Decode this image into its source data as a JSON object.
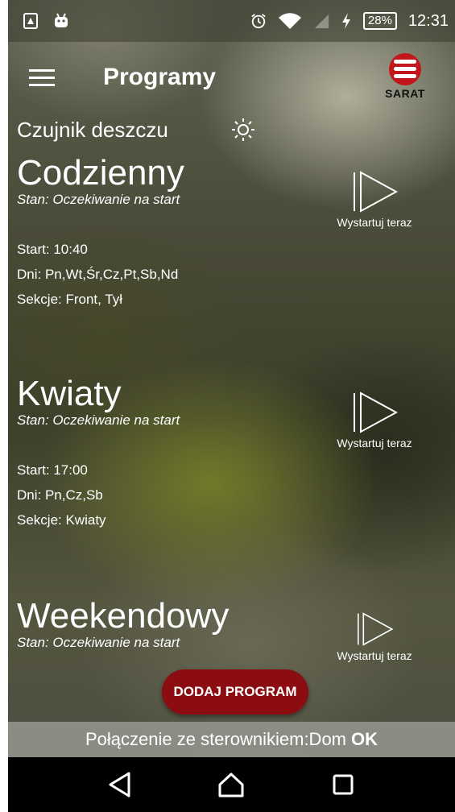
{
  "status_bar": {
    "battery_percent": "28%",
    "time": "12:31",
    "icons": [
      "sim-card-icon",
      "android-icon",
      "alarm-icon",
      "wifi-icon",
      "signal-icon",
      "charging-icon"
    ]
  },
  "app_bar": {
    "title": "Programy",
    "logo_text": "SARAT"
  },
  "rain_sensor": {
    "label": "Czujnik deszczu",
    "icon": "sun-icon"
  },
  "programs": [
    {
      "name": "Codzienny",
      "status": "Stan: Oczekiwanie na start",
      "start": "Start: 10:40",
      "days": "Dni: Pn,Wt,Śr,Cz,Pt,Sb,Nd",
      "sections": "Sekcje: Front, Tył",
      "start_now_label": "Wystartuj teraz"
    },
    {
      "name": "Kwiaty",
      "status": "Stan: Oczekiwanie na start",
      "start": "Start: 17:00",
      "days": "Dni: Pn,Cz,Sb",
      "sections": "Sekcje: Kwiaty",
      "start_now_label": "Wystartuj teraz"
    },
    {
      "name": "Weekendowy",
      "status": "Stan: Oczekiwanie na start",
      "start_now_label": "Wystartuj teraz"
    }
  ],
  "add_program_button": "DODAJ PROGRAM",
  "connection": {
    "label": "Połączenie ze sterownikiem:Dom",
    "status": "OK"
  },
  "colors": {
    "accent_button": "#8b0d12",
    "logo_red": "#c0161c"
  }
}
